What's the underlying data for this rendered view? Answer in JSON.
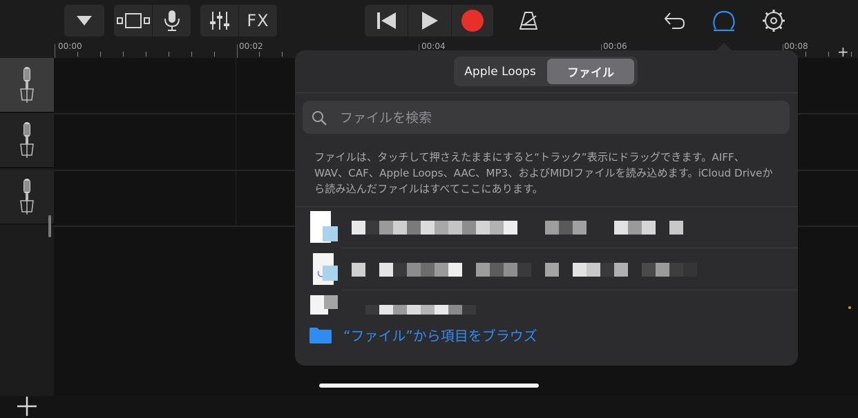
{
  "toolbar": {
    "fx_label": "FX"
  },
  "ruler": {
    "labels": [
      "00:00",
      "00:02",
      "00:04",
      "00:06",
      "00:08"
    ]
  },
  "popover": {
    "tabs": [
      {
        "label": "Apple Loops",
        "active": false
      },
      {
        "label": "ファイル",
        "active": true
      }
    ],
    "search": {
      "placeholder": "ファイルを検索",
      "value": ""
    },
    "info_text": "ファイルは、タッチして押さえたままにすると“トラック”表示にドラッグできます。AIFF、WAV、CAF、Apple Loops、AAC、MP3、およびMIDIファイルを読み込めます。iCloud Driveから読み込んだファイルはすべてここにあります。",
    "browse_label": "“ファイル”から項目をブラウズ"
  },
  "colors": {
    "accent_blue": "#2f8cf1",
    "record_red": "#e8302a",
    "background": "#141414",
    "popover_bg": "#2c2c2e"
  },
  "icons": {
    "toolbar": [
      "triangle-down-icon",
      "track-view-icon",
      "microphone-icon",
      "mixer-icon",
      "go-to-start-icon",
      "play-icon",
      "record-icon",
      "metronome-icon",
      "undo-icon",
      "loop-browser-icon",
      "settings-icon"
    ],
    "track_instrument": "microphone-instrument-icon",
    "browse": "folder-icon"
  }
}
